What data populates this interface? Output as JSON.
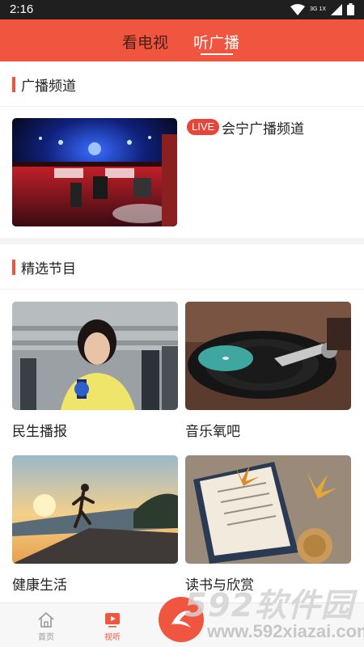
{
  "status_bar": {
    "time": "2:16",
    "network": "3G 1X"
  },
  "top_tabs": [
    {
      "label": "看电视"
    },
    {
      "label": "听广播"
    }
  ],
  "colors": {
    "accent": "#f0553f",
    "live_badge": "#e8453a"
  },
  "radio_section": {
    "title": "广播频道",
    "channel": {
      "badge": "LIVE",
      "name": "会宁广播频道"
    }
  },
  "programs_section": {
    "title": "精选节目",
    "items": [
      {
        "title": "民生播报"
      },
      {
        "title": "音乐氧吧"
      },
      {
        "title": "健康生活"
      },
      {
        "title": "读书与欣赏"
      }
    ]
  },
  "bottom_nav": {
    "items": [
      {
        "label": "首页",
        "icon": "home-icon"
      },
      {
        "label": "视听",
        "icon": "play-icon",
        "active": true
      }
    ]
  },
  "watermark": {
    "logo_text": "592软件园",
    "site": "www.592xiazai.com"
  }
}
